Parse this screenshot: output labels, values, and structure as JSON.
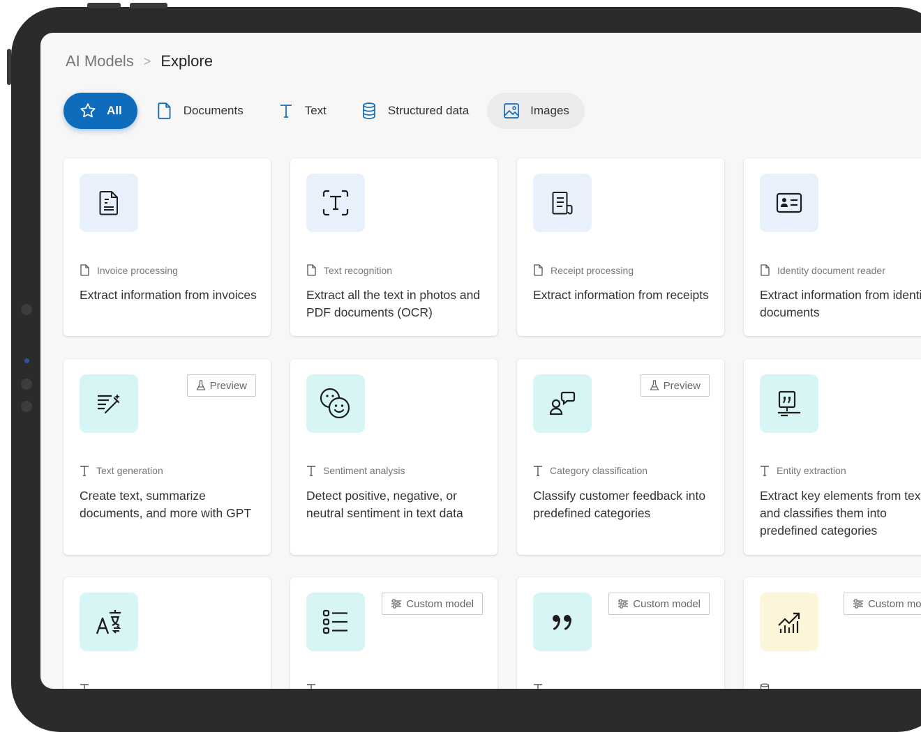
{
  "breadcrumb": {
    "root": "AI Models",
    "current": "Explore"
  },
  "tabs": [
    {
      "label": "All",
      "icon": "star-icon",
      "state": "active"
    },
    {
      "label": "Documents",
      "icon": "document-icon",
      "state": "normal"
    },
    {
      "label": "Text",
      "icon": "text-icon",
      "state": "normal"
    },
    {
      "label": "Structured data",
      "icon": "database-icon",
      "state": "normal"
    },
    {
      "label": "Images",
      "icon": "image-icon",
      "state": "hover"
    }
  ],
  "cards": [
    {
      "category": "Invoice processing",
      "category_icon": "document-icon",
      "description": "Extract information from invoices",
      "tile_icon": "invoice-icon",
      "tile_color": "blue",
      "badge": ""
    },
    {
      "category": "Text recognition",
      "category_icon": "document-icon",
      "description": "Extract all the text in photos and PDF documents (OCR)",
      "tile_icon": "text-recognition-icon",
      "tile_color": "blue",
      "badge": ""
    },
    {
      "category": "Receipt processing",
      "category_icon": "document-icon",
      "description": "Extract information from receipts",
      "tile_icon": "receipt-icon",
      "tile_color": "blue",
      "badge": ""
    },
    {
      "category": "Identity document reader",
      "category_icon": "document-icon",
      "description": "Extract information from identity documents",
      "tile_icon": "id-card-icon",
      "tile_color": "blue",
      "badge": ""
    },
    {
      "category": "Text generation",
      "category_icon": "text-icon",
      "description": "Create text, summarize documents, and more with GPT",
      "tile_icon": "text-generation-icon",
      "tile_color": "teal",
      "badge": "Preview",
      "badge_icon": "flask-icon"
    },
    {
      "category": "Sentiment analysis",
      "category_icon": "text-icon",
      "description": "Detect positive, negative, or neutral sentiment in text data",
      "tile_icon": "emoji-icon",
      "tile_color": "teal",
      "badge": ""
    },
    {
      "category": "Category classification",
      "category_icon": "text-icon",
      "description": "Classify customer feedback into predefined categories",
      "tile_icon": "feedback-icon",
      "tile_color": "teal",
      "badge": "Preview",
      "badge_icon": "flask-icon"
    },
    {
      "category": "Entity extraction",
      "category_icon": "text-icon",
      "description": "Extract key elements from text, and classifies them into predefined categories",
      "tile_icon": "entity-icon",
      "tile_color": "teal",
      "badge": ""
    },
    {
      "category": "",
      "category_icon": "text-icon",
      "description": "",
      "tile_icon": "translate-icon",
      "tile_color": "teal",
      "badge": ""
    },
    {
      "category": "",
      "category_icon": "text-icon",
      "description": "",
      "tile_icon": "list-icon",
      "tile_color": "teal",
      "badge": "Custom model",
      "badge_icon": "sliders-icon"
    },
    {
      "category": "",
      "category_icon": "text-icon",
      "description": "",
      "tile_icon": "quote-icon",
      "tile_color": "teal",
      "badge": "Custom model",
      "badge_icon": "sliders-icon"
    },
    {
      "category": "",
      "category_icon": "database-icon",
      "description": "",
      "tile_icon": "prediction-chart-icon",
      "tile_color": "yellow",
      "badge": "Custom mod",
      "badge_icon": "sliders-icon"
    }
  ]
}
